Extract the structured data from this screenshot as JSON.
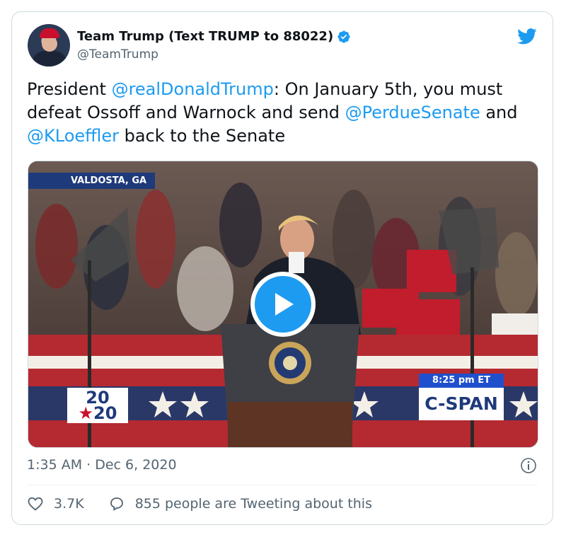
{
  "tweet": {
    "display_name": "Team Trump (Text TRUMP to 88022)",
    "handle": "@TeamTrump",
    "text_parts": [
      {
        "text": "President ",
        "type": "plain"
      },
      {
        "text": "@realDonaldTrump",
        "type": "mention"
      },
      {
        "text": ": On January 5th, you must defeat Ossoff and Warnock and send ",
        "type": "plain"
      },
      {
        "text": "@PerdueSenate",
        "type": "mention"
      },
      {
        "text": " and ",
        "type": "plain"
      },
      {
        "text": "@KLoeffler",
        "type": "mention"
      },
      {
        "text": " back to the Senate",
        "type": "plain"
      }
    ],
    "timestamp": "1:35 AM · Dec 6, 2020"
  },
  "video": {
    "location_chyron": "VALDOSTA, GA",
    "time_chyron": "8:25 pm ET",
    "network": "C-SPAN",
    "year_top": "20",
    "year_bottom": "20",
    "year_star": "★"
  },
  "engagement": {
    "likes": "3.7K",
    "conversation": "855 people are Tweeting about this"
  },
  "icons": {
    "verified": "verified-badge-icon",
    "bird": "twitter-bird-icon",
    "play": "play-icon",
    "info": "info-icon",
    "heart": "heart-icon",
    "reply": "speech-bubble-icon"
  },
  "colors": {
    "accent": "#1d9bf0",
    "text": "#0f1419",
    "muted": "#536471",
    "cspan_blue": "#1f3a7a"
  }
}
